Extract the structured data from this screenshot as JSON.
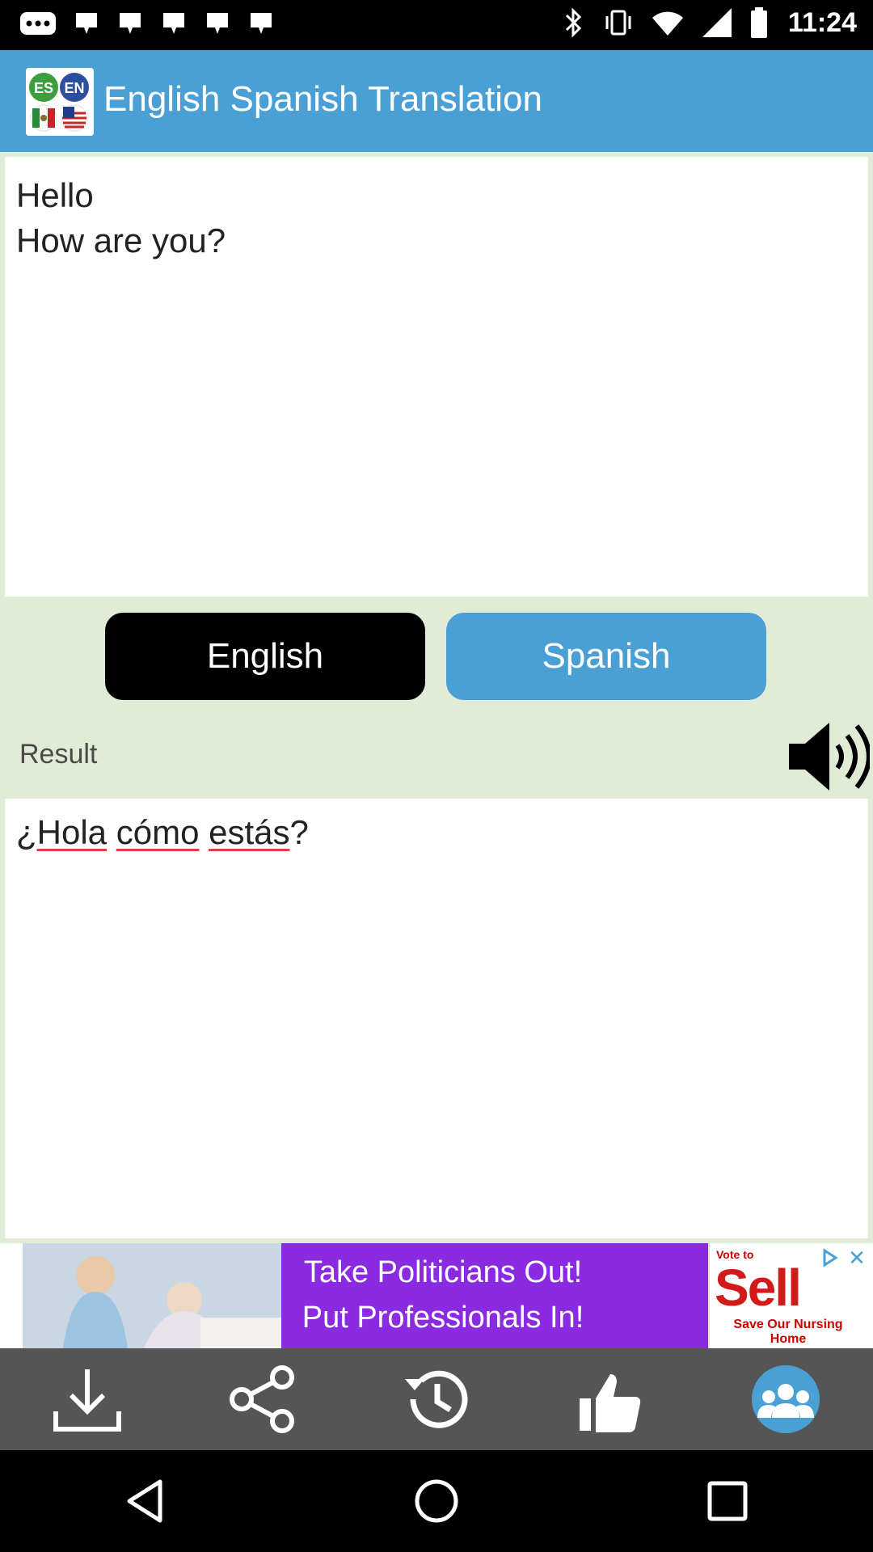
{
  "status_bar": {
    "time": "11:24"
  },
  "app_bar": {
    "title": "English Spanish Translation",
    "logo_left_text": "ES",
    "logo_right_text": "EN"
  },
  "input": {
    "lines": [
      "Hello",
      "How are you?"
    ]
  },
  "languages": {
    "source_label": "English",
    "target_label": "Spanish"
  },
  "result": {
    "label": "Result",
    "text_parts": [
      "¿",
      "Hola",
      " ",
      "cómo",
      " ",
      "estás",
      "?"
    ]
  },
  "ad": {
    "line1": "Take Politicians Out!",
    "line2": "Put Professionals In!",
    "badge_top": "Vote to",
    "badge_main": "Sell",
    "badge_sub": "Save Our Nursing Home"
  },
  "toolbar": {
    "items": [
      "download-icon",
      "share-icon",
      "history-icon",
      "thumbs-up-icon",
      "community-icon"
    ]
  },
  "colors": {
    "accent": "#4aa0d5",
    "toolbar": "#555555",
    "background": "#e0ecd6"
  }
}
